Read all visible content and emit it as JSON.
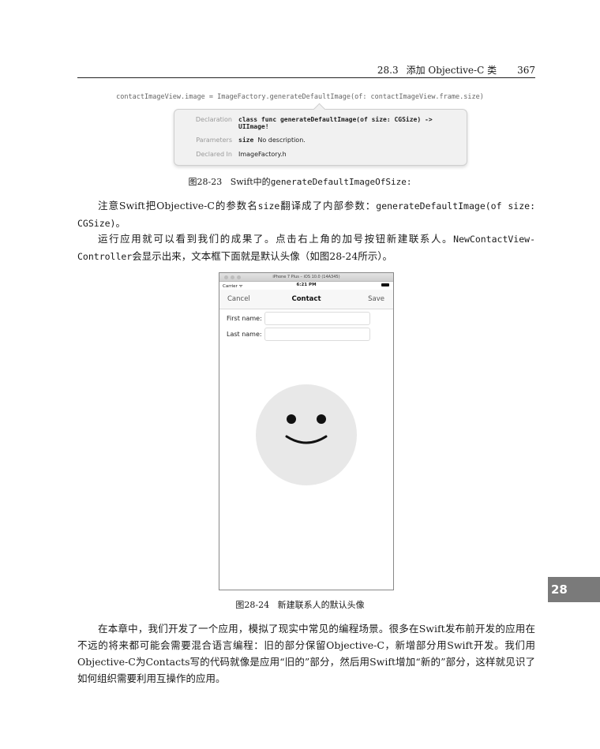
{
  "header": {
    "section": "28.3",
    "title": "添加 Objective-C 类",
    "page_number": "367"
  },
  "code_line": "contactImageView.image = ImageFactory.generateDefaultImage(of: contactImageView.frame.size)",
  "popover": {
    "declaration_label": "Declaration",
    "declaration_line1": "class func generateDefaultImage(of size: CGSize) ->",
    "declaration_line2": "UIImage!",
    "parameters_label": "Parameters",
    "param_name": "size",
    "param_desc": "No description.",
    "declared_in_label": "Declared In",
    "declared_in": "ImageFactory.h"
  },
  "figure1": {
    "number": "图28-23",
    "caption_pre": "Swift中的",
    "caption_code": "generateDefaultImageOfSize:"
  },
  "para1": {
    "t1": "注意Swift把Objective-C的参数名",
    "c1": "size",
    "t2": "翻译成了内部参数：",
    "c2": "generateDefaultImage(of size:",
    "c3": "CGSize)",
    "t3": "。"
  },
  "para2": {
    "t1": "运行应用就可以看到我们的成果了。点击右上角的加号按钮新建联系人。",
    "c1": "NewContactView-",
    "c2": "Controller",
    "t2": "会显示出来，文本框下面就是默认头像（如图28-24所示）。"
  },
  "phone": {
    "window_title": "iPhone 7 Plus – iOS 10.0 (14A345)",
    "carrier": "Carrier ᯤ",
    "time": "6:21 PM",
    "cancel": "Cancel",
    "title": "Contact",
    "save": "Save",
    "first_name_label": "First name:",
    "last_name_label": "Last name:",
    "first_name_value": "",
    "last_name_value": ""
  },
  "figure2": {
    "number": "图28-24",
    "caption": "新建联系人的默认头像"
  },
  "para3": "在本章中，我们开发了一个应用，模拟了现实中常见的编程场景。很多在Swift发布前开发的应用在不远的将来都可能会需要混合语言编程：旧的部分保留Objective-C，新增部分用Swift开发。我们用Objective-C为Contacts写的代码就像是应用“旧的”部分，然后用Swift增加“新的”部分，这样就见识了如何组织需要利用互操作的应用。",
  "chapter_tab": "28"
}
